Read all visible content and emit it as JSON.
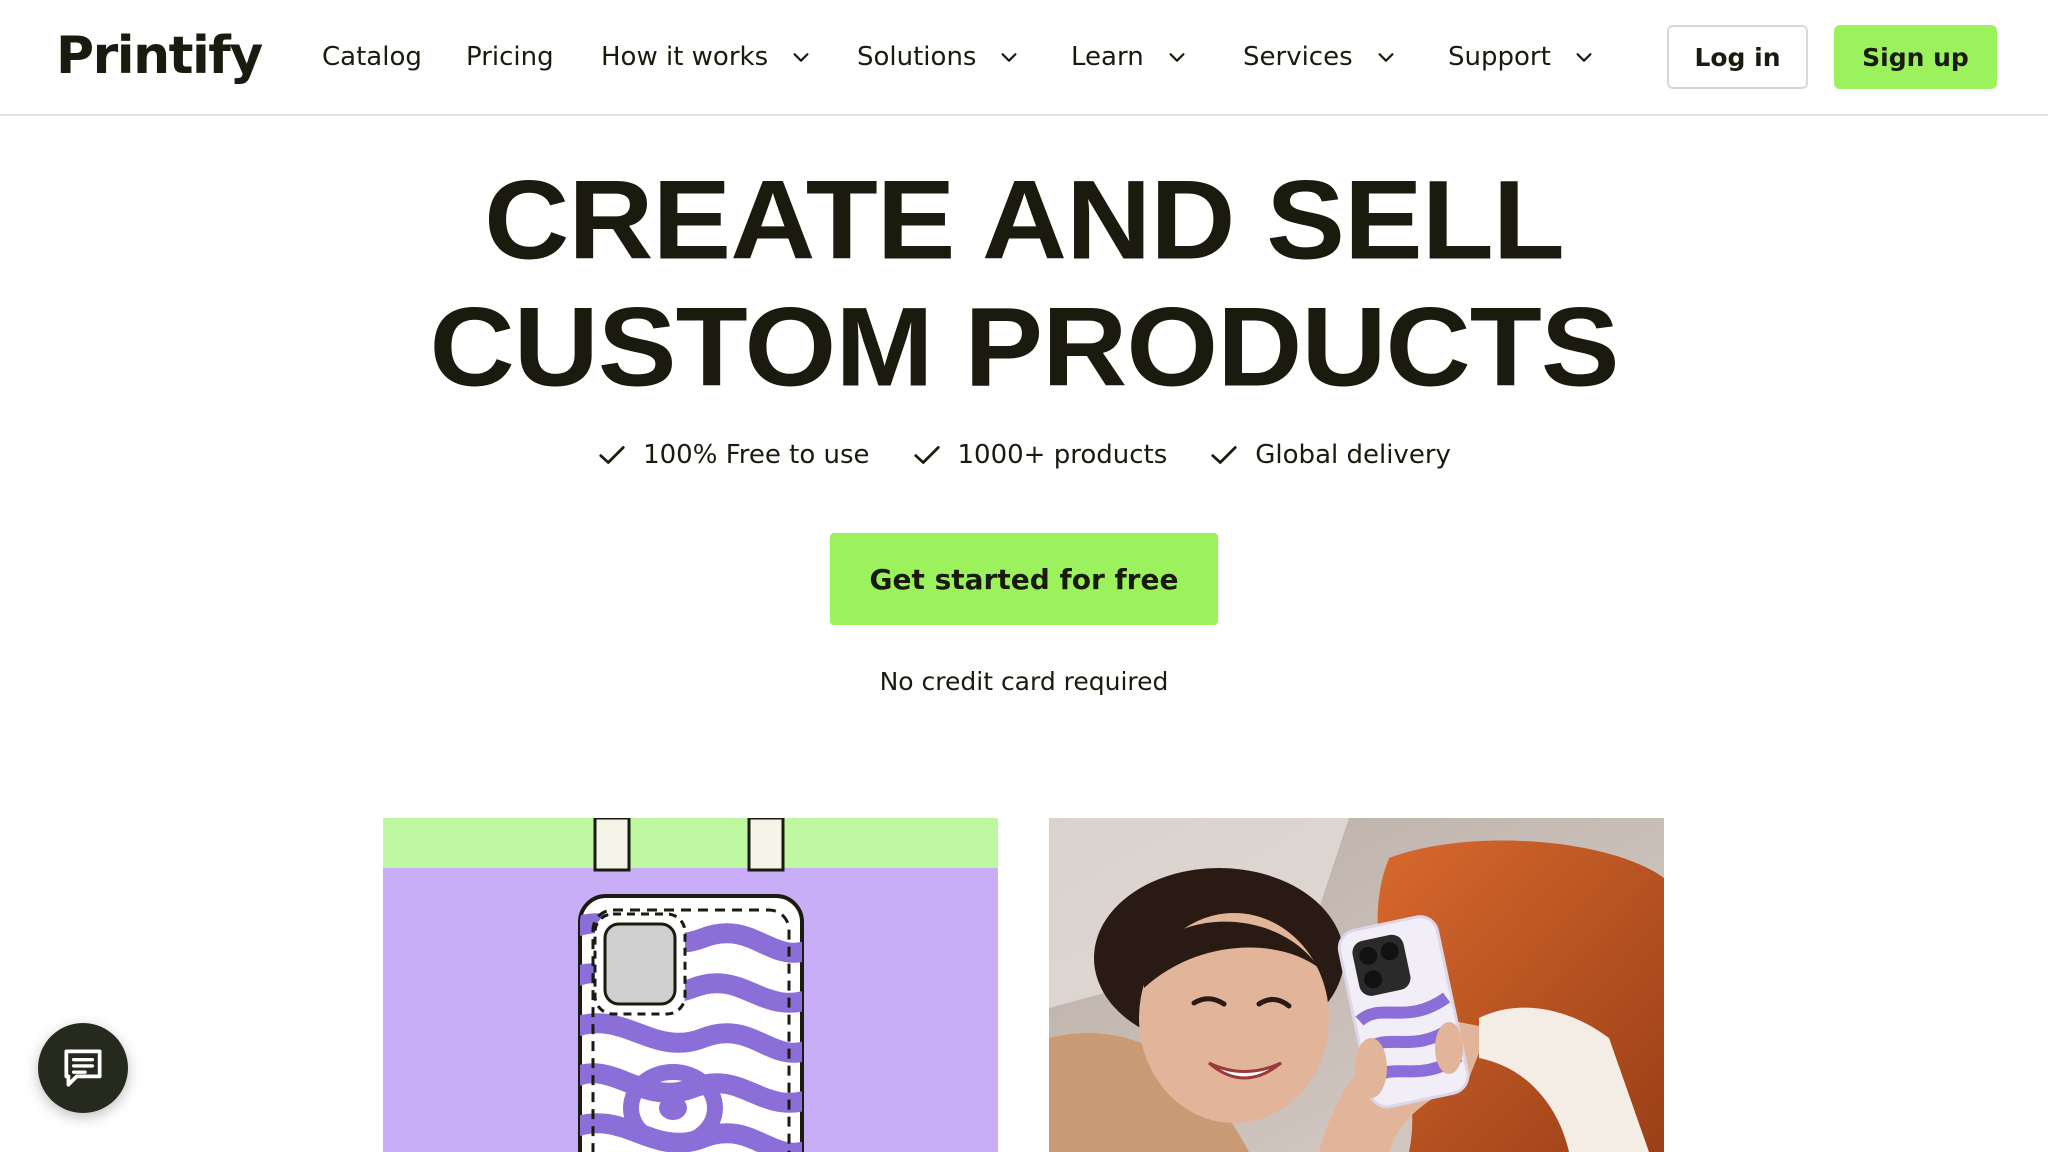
{
  "brand": {
    "logo_text": "Printify"
  },
  "nav": {
    "items": [
      {
        "label": "Catalog",
        "has_dropdown": false
      },
      {
        "label": "Pricing",
        "has_dropdown": false
      },
      {
        "label": "How it works",
        "has_dropdown": true
      },
      {
        "label": "Solutions",
        "has_dropdown": true
      },
      {
        "label": "Learn",
        "has_dropdown": true
      },
      {
        "label": "Services",
        "has_dropdown": true
      },
      {
        "label": "Support",
        "has_dropdown": true
      }
    ],
    "login_label": "Log in",
    "signup_label": "Sign up"
  },
  "hero": {
    "headline_line1": "CREATE AND SELL",
    "headline_line2": "CUSTOM PRODUCTS",
    "features": [
      {
        "label": "100% Free to use",
        "icon": "check-icon"
      },
      {
        "label": "1000+ products",
        "icon": "check-icon"
      },
      {
        "label": "Global delivery",
        "icon": "check-icon"
      }
    ],
    "cta_label": "Get started for free",
    "note": "No credit card required"
  },
  "showcase": {
    "left_image": "phone-case-design-mockup",
    "right_image": "woman-holding-phone-with-custom-case"
  },
  "chat": {
    "icon": "chat-icon"
  },
  "colors": {
    "accent": "#9bf25c",
    "text": "#1a1a0e",
    "lavender": "#c8aef7",
    "purple_pattern": "#8b6ed8",
    "chat_bg": "#262a1e"
  }
}
